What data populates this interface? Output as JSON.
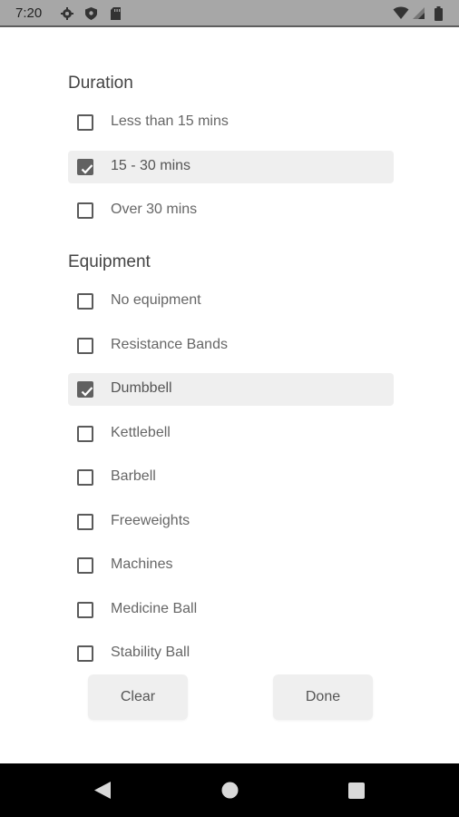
{
  "status_bar": {
    "time": "7:20",
    "icons": [
      "settings-icon",
      "shield-icon",
      "sd-card-icon",
      "wifi-icon",
      "signal-icon",
      "battery-icon"
    ]
  },
  "sections": [
    {
      "title": "Duration",
      "options": [
        {
          "label": "Less than 15 mins",
          "checked": false
        },
        {
          "label": "15 - 30 mins",
          "checked": true
        },
        {
          "label": "Over 30 mins",
          "checked": false
        }
      ]
    },
    {
      "title": "Equipment",
      "options": [
        {
          "label": "No equipment",
          "checked": false
        },
        {
          "label": "Resistance Bands",
          "checked": false
        },
        {
          "label": "Dumbbell",
          "checked": true
        },
        {
          "label": "Kettlebell",
          "checked": false
        },
        {
          "label": "Barbell",
          "checked": false
        },
        {
          "label": "Freeweights",
          "checked": false
        },
        {
          "label": "Machines",
          "checked": false
        },
        {
          "label": "Medicine Ball",
          "checked": false
        },
        {
          "label": "Stability Ball",
          "checked": false
        }
      ]
    }
  ],
  "actions": {
    "clear_label": "Clear",
    "done_label": "Done"
  },
  "nav_bar": {
    "icons": [
      "back-icon",
      "home-icon",
      "recents-icon"
    ]
  }
}
